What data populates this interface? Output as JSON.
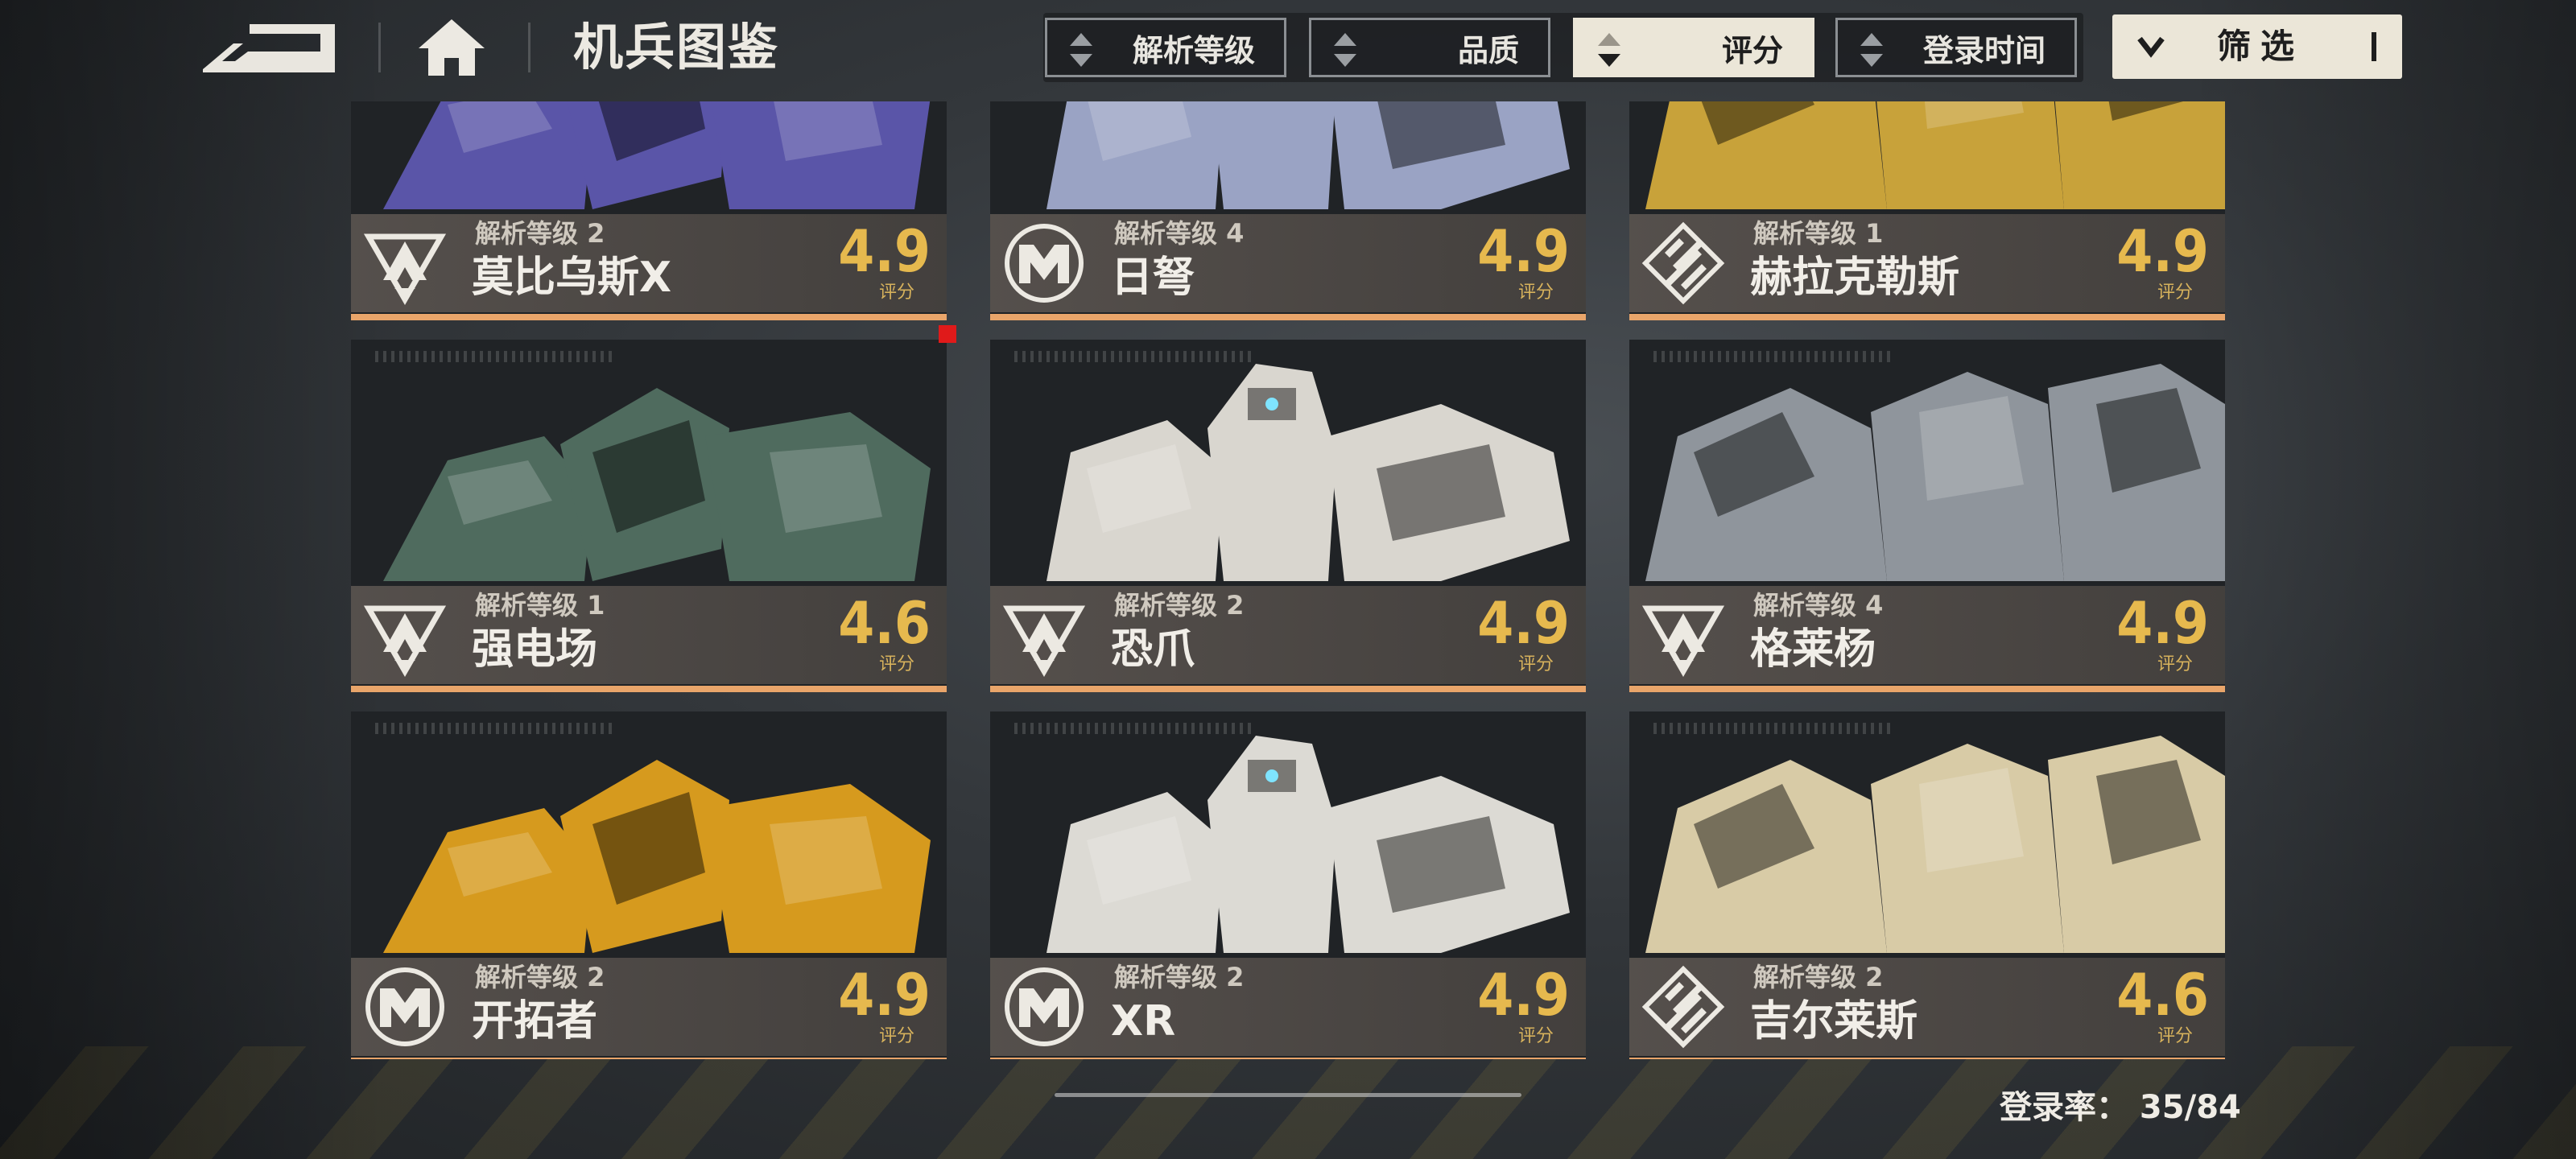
{
  "header": {
    "title": "机兵图鉴",
    "sort_options": [
      {
        "label": "解析等级",
        "active": false
      },
      {
        "label": "品质",
        "active": false
      },
      {
        "label": "评分",
        "active": true
      },
      {
        "label": "登录时间",
        "active": false
      }
    ],
    "filter_label": "筛选"
  },
  "cards": [
    {
      "level": "解析等级 2",
      "name": "莫比乌斯X",
      "score": "4.9",
      "score_label": "评分",
      "faction_icon": "delta-triangle-icon",
      "color": "#5a55a8",
      "new": false
    },
    {
      "level": "解析等级 4",
      "name": "日弩",
      "score": "4.9",
      "score_label": "评分",
      "faction_icon": "m-hex-icon",
      "color": "#9aa3c4",
      "new": false
    },
    {
      "level": "解析等级 1",
      "name": "赫拉克勒斯",
      "score": "4.9",
      "score_label": "评分",
      "faction_icon": "stripe-diamond-icon",
      "color": "#c8a23a",
      "new": false
    },
    {
      "level": "解析等级 1",
      "name": "强电场",
      "score": "4.6",
      "score_label": "评分",
      "faction_icon": "delta-triangle-icon",
      "color": "#4f6b5e",
      "new": true
    },
    {
      "level": "解析等级 2",
      "name": "恐爪",
      "score": "4.9",
      "score_label": "评分",
      "faction_icon": "delta-triangle-icon",
      "color": "#d9d6cf",
      "new": false
    },
    {
      "level": "解析等级 4",
      "name": "格莱杨",
      "score": "4.9",
      "score_label": "评分",
      "faction_icon": "delta-triangle-icon",
      "color": "#8f959c",
      "new": false
    },
    {
      "level": "解析等级 2",
      "name": "开拓者",
      "score": "4.9",
      "score_label": "评分",
      "faction_icon": "m-hex-icon",
      "color": "#d69a1e",
      "new": false
    },
    {
      "level": "解析等级 2",
      "name": "XR",
      "score": "4.9",
      "score_label": "评分",
      "faction_icon": "m-hex-icon",
      "color": "#dcdad4",
      "new": false
    },
    {
      "level": "解析等级 2",
      "name": "吉尔莱斯",
      "score": "4.6",
      "score_label": "评分",
      "faction_icon": "stripe-diamond-icon",
      "color": "#d8cba6",
      "new": false
    }
  ],
  "footer": {
    "collection_rate": "登录率： 35/84"
  }
}
